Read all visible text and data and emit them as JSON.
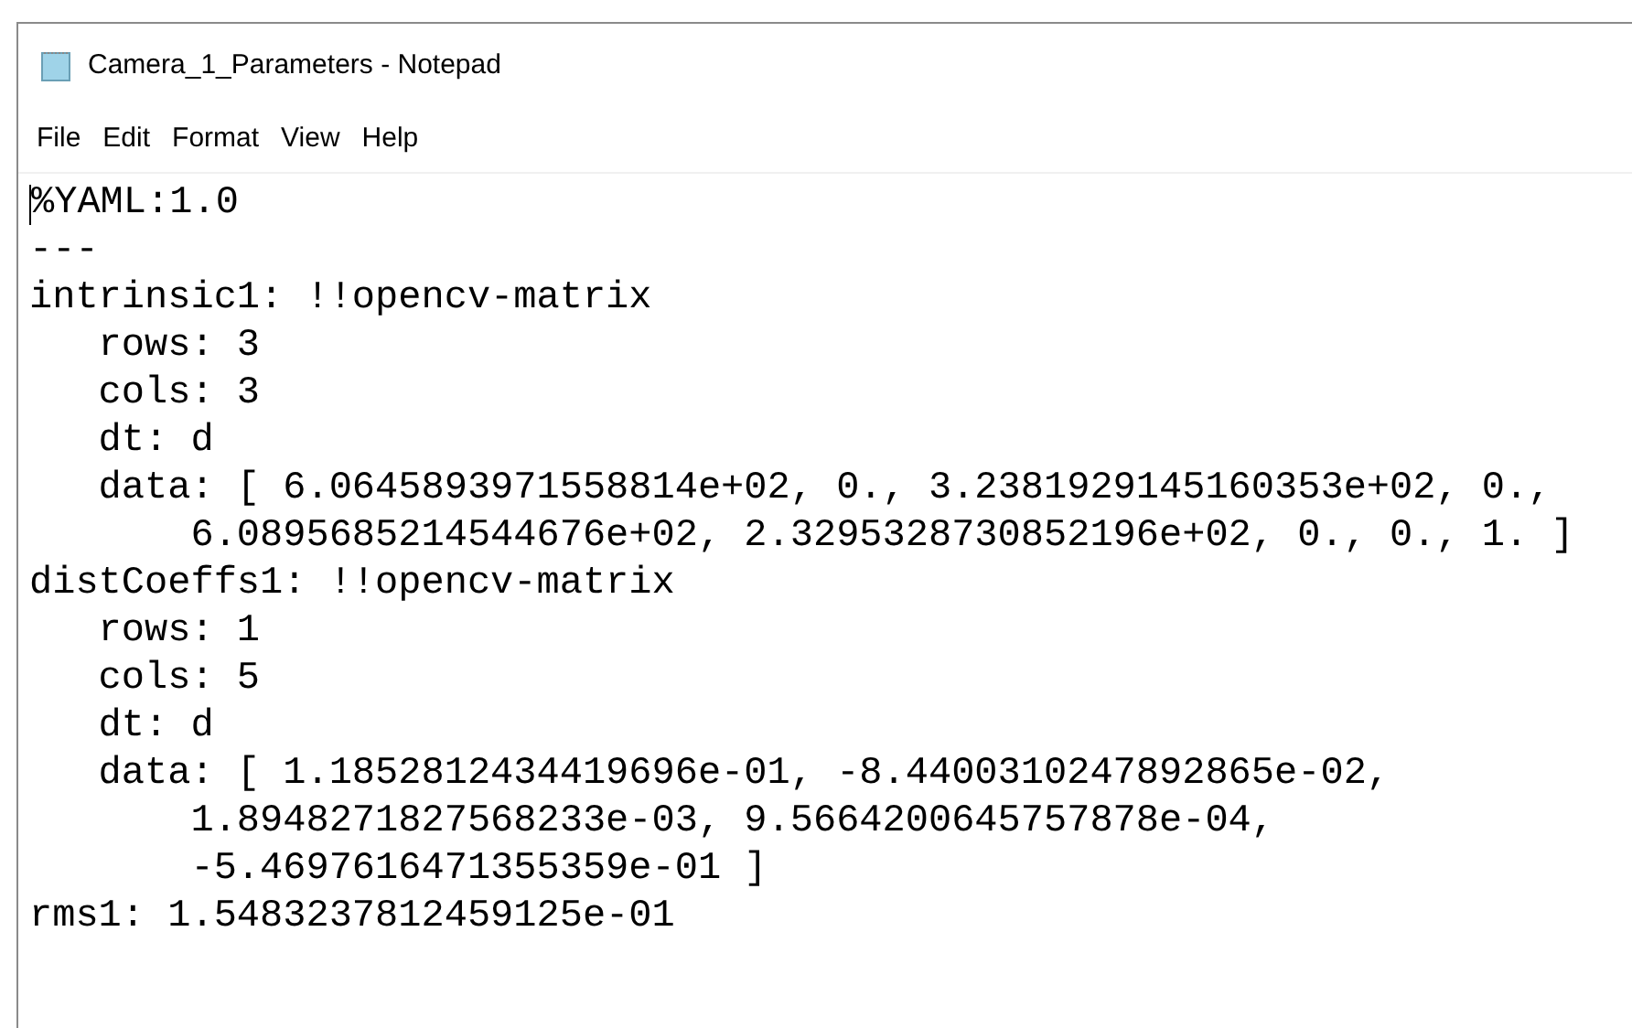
{
  "window": {
    "title": "Camera_1_Parameters - Notepad"
  },
  "menu": [
    "File",
    "Edit",
    "Format",
    "View",
    "Help"
  ],
  "editor": {
    "lines": [
      "%YAML:1.0",
      "---",
      "intrinsic1: !!opencv-matrix",
      "   rows: 3",
      "   cols: 3",
      "   dt: d",
      "   data: [ 6.0645893971558814e+02, 0., 3.2381929145160353e+02, 0.,",
      "       6.0895685214544676e+02, 2.3295328730852196e+02, 0., 0., 1. ]",
      "distCoeffs1: !!opencv-matrix",
      "   rows: 1",
      "   cols: 5",
      "   dt: d",
      "   data: [ 1.1852812434419696e-01, -8.4400310247892865e-02,",
      "       1.8948271827568233e-03, 9.5664200645757878e-04,",
      "       -5.4697616471355359e-01 ]",
      "rms1: 1.5483237812459125e-01"
    ]
  }
}
